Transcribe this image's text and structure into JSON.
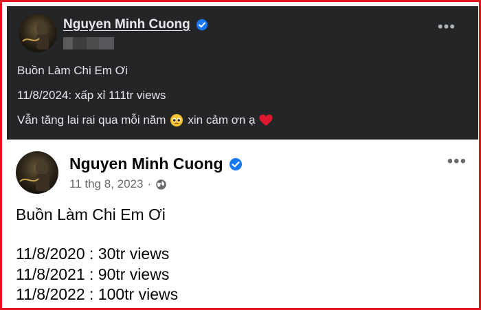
{
  "dark_post": {
    "author": "Nguyen Minh Cuong",
    "title_line": "Buồn Làm Chi Em Ơi",
    "views_line": "11/8/2024: xấp xỉ 111tr views",
    "thanks_text_before": "Vẫn tăng lai rai qua mỗi năm",
    "thanks_text_after": "xin cảm ơn ạ",
    "emoji_1": "pleading-face-icon",
    "emoji_2": "red-heart-icon",
    "more_label": "•••"
  },
  "light_post": {
    "author": "Nguyen Minh Cuong",
    "date": "11 thg 8, 2023",
    "separator": "·",
    "title_line": "Buồn Làm Chi Em Ơi",
    "stats": [
      "11/8/2020 : 30tr views",
      "11/8/2021 : 90tr views",
      "11/8/2022 : 100tr views"
    ],
    "more_label": "•••"
  },
  "colors": {
    "frame_border": "#e0141e",
    "dark_bg": "#242526",
    "verified_blue": "#1877f2"
  }
}
